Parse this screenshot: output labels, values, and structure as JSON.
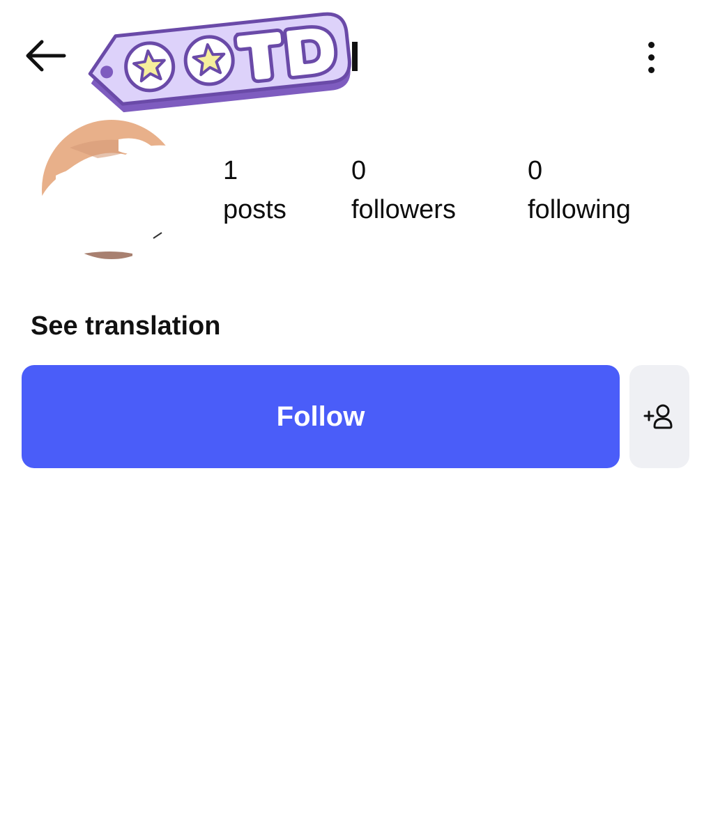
{
  "header": {
    "back_icon": "arrow-left-icon",
    "more_icon": "more-vertical-icon",
    "sticker_text": "OOTD"
  },
  "profile": {
    "stats": [
      {
        "value": "1",
        "label": "posts"
      },
      {
        "value": "0",
        "label": "followers"
      },
      {
        "value": "0",
        "label": "following"
      }
    ],
    "see_translation_label": "See translation"
  },
  "actions": {
    "follow_label": "Follow",
    "suggest_icon": "add-person-icon"
  },
  "colors": {
    "follow_button": "#4a5df9",
    "secondary_button": "#eff0f4",
    "sticker_fill": "#ddd2fa",
    "sticker_outline": "#7e5cbf",
    "star": "#f6ee9c"
  }
}
